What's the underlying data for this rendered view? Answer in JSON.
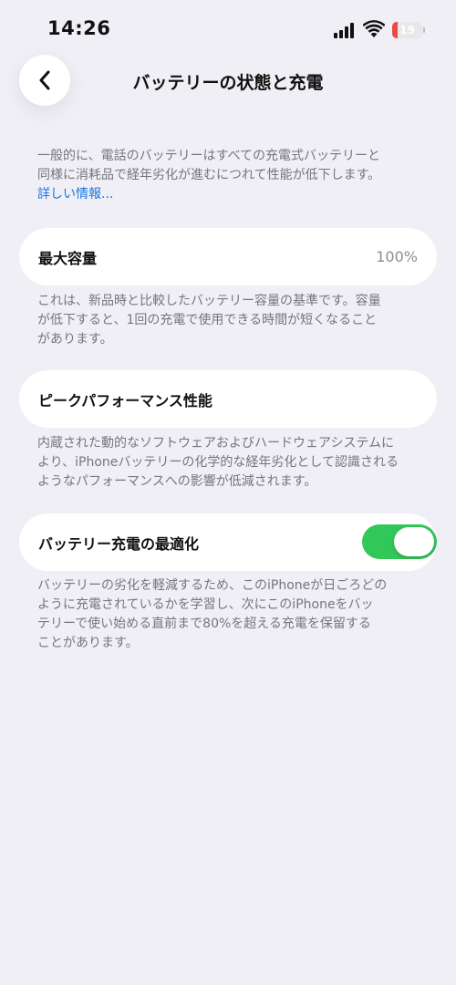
{
  "status_bar": {
    "time": "14:26",
    "battery_level": "19",
    "battery_fraction": 0.19,
    "battery_color": "#ea4949",
    "icons": [
      "cellular-signal-icon",
      "wifi-icon",
      "battery-icon"
    ]
  },
  "nav": {
    "back_icon": "chevron-left-icon",
    "title": "バッテリーの状態と充電"
  },
  "intro": {
    "line1": "一般的に、電話のバッテリーはすべての充電式バッテリーと",
    "line2": "同様に消耗品で経年劣化が進むにつれて性能が低下します。",
    "link": "詳しい情報..."
  },
  "max_capacity": {
    "label": "最大容量",
    "value": "100%",
    "note_line1": "これは、新品時と比較したバッテリー容量の基準です。容量",
    "note_line2": "が低下すると、1回の充電で使用できる時間が短くなること",
    "note_line3": "があります。"
  },
  "peak_performance": {
    "label": "ピークパフォーマンス性能",
    "note_line1": "内蔵された動的なソフトウェアおよびハードウェアシステムに",
    "note_line2": "より、iPhoneバッテリーの化学的な経年劣化として認識される",
    "note_line3": "ようなパフォーマンスへの影響が低減されます。"
  },
  "optimized_charging": {
    "label": "バッテリー充電の最適化",
    "enabled": true,
    "toggle_color": "#32c759",
    "note_line1": "バッテリーの劣化を軽減するため、このiPhoneが日ごろどの",
    "note_line2": "ように充電されているかを学習し、次にこのiPhoneをバッ",
    "note_line3": "テリーで使い始める直前まで80%を超える充電を保留する",
    "note_line4": "ことがあります。"
  },
  "colors": {
    "background": "#f0eff5",
    "card": "#ffffff",
    "link": "#1a77e6",
    "secondary_text": "#75757b"
  }
}
